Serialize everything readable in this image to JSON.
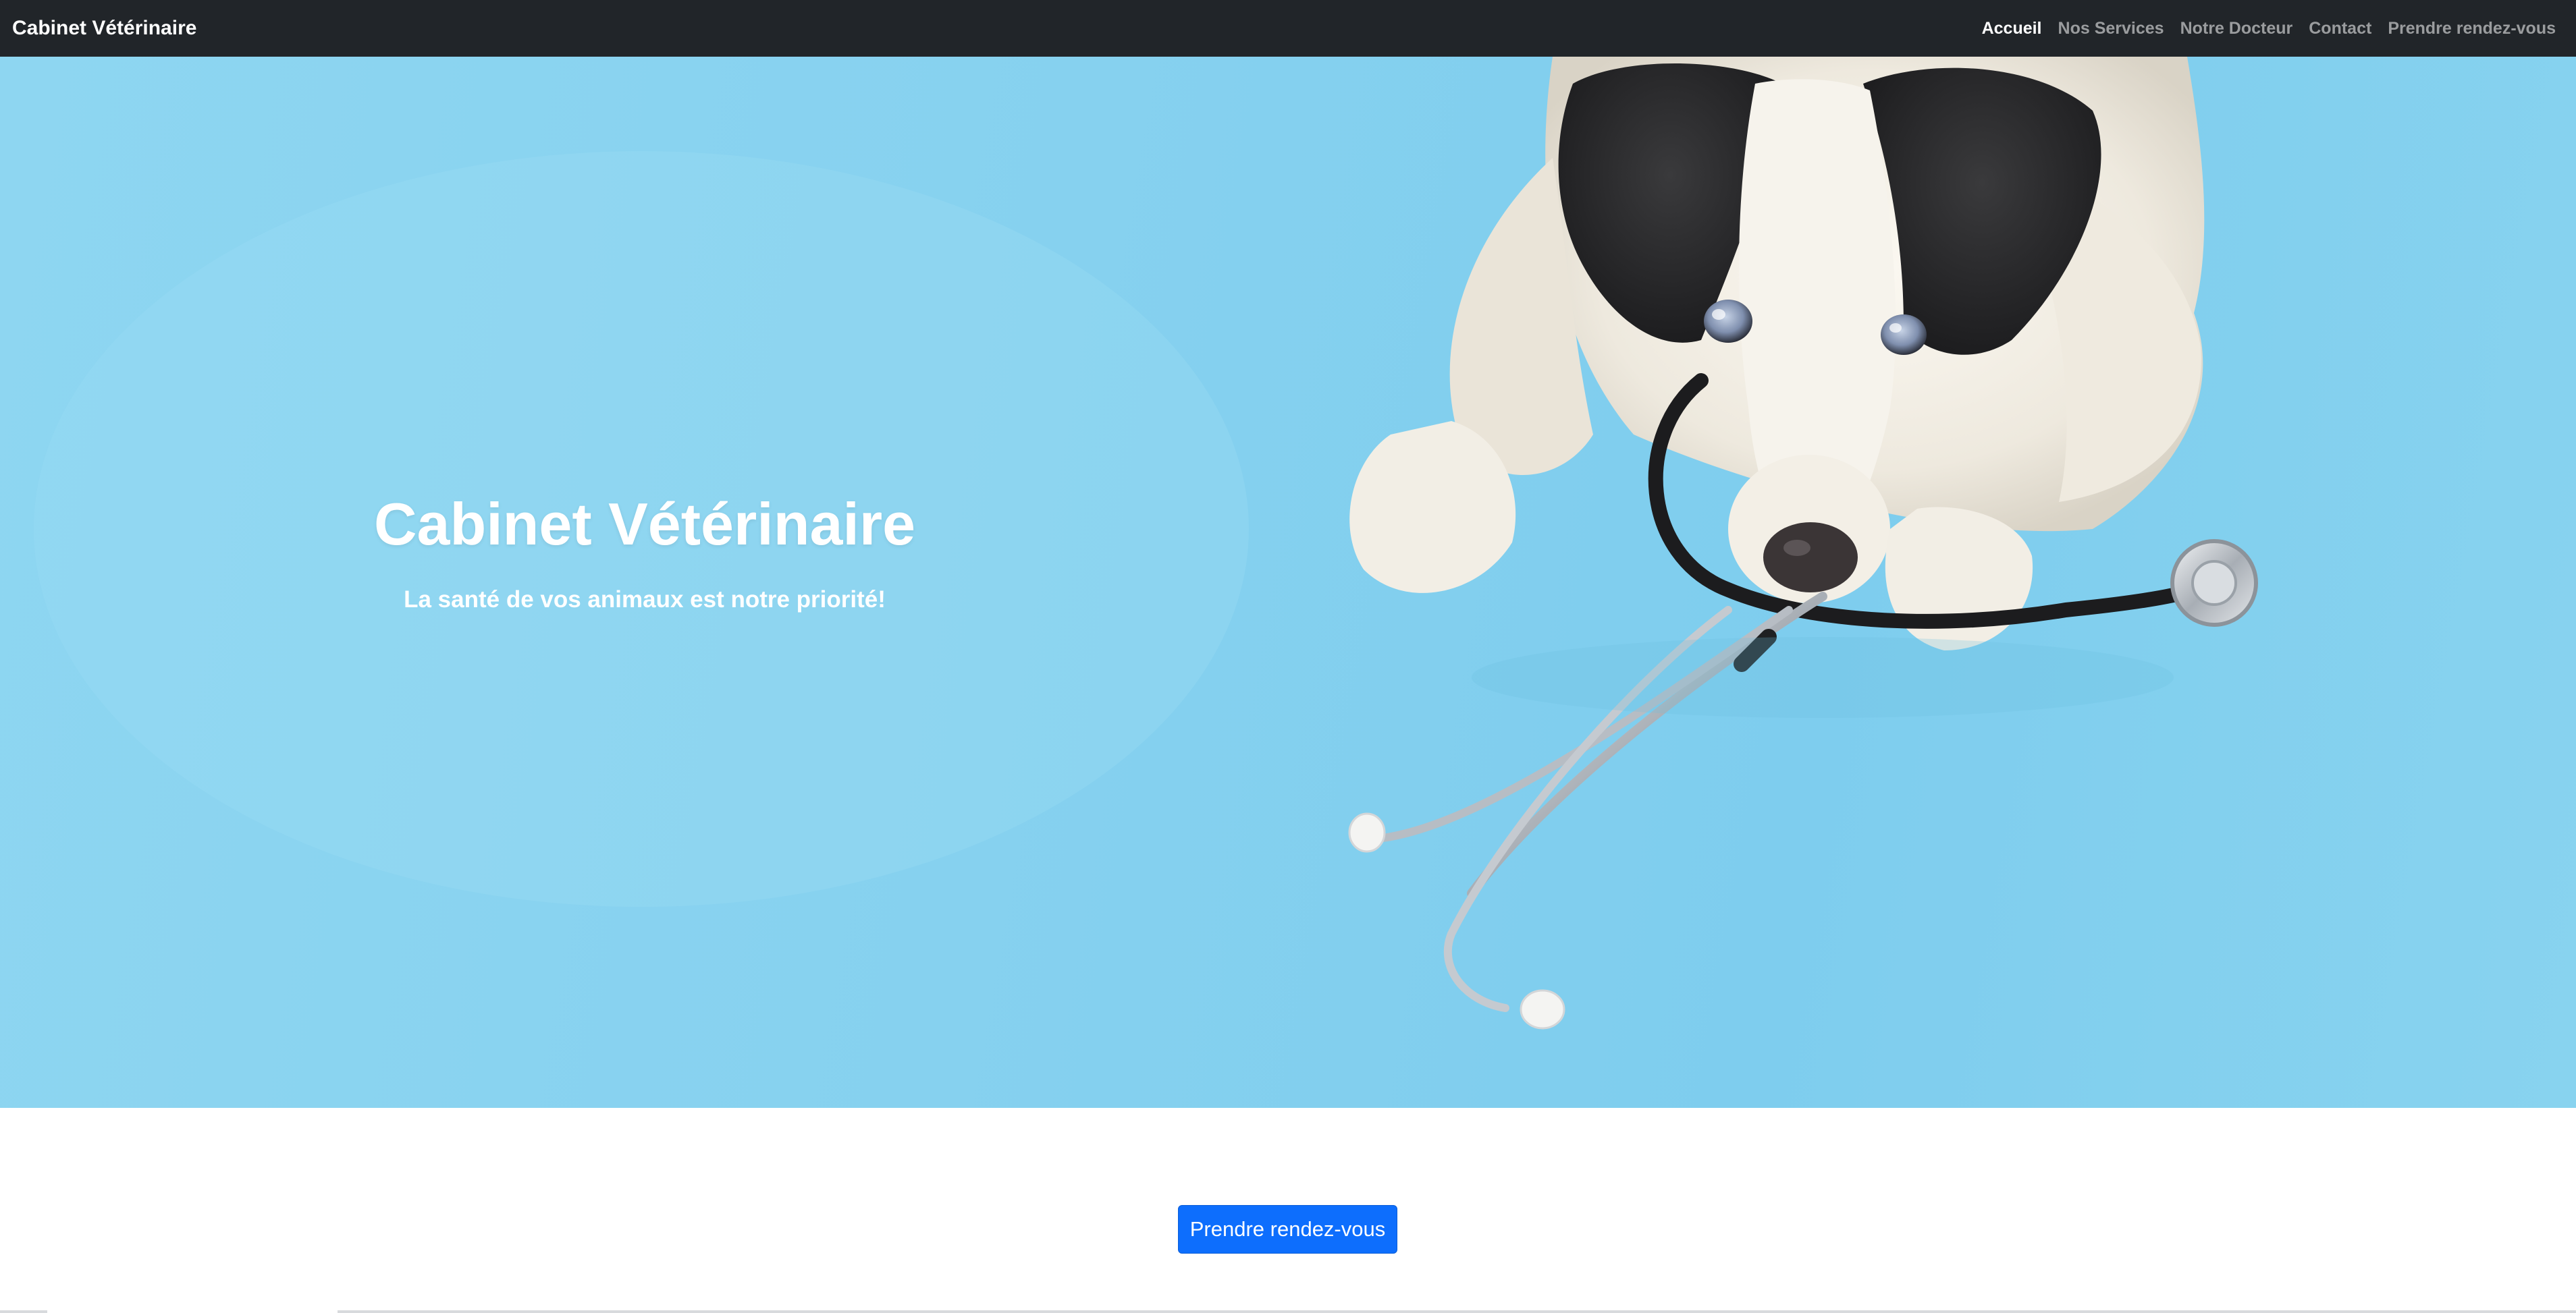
{
  "navbar": {
    "brand": "Cabinet Vétérinaire",
    "links": [
      {
        "label": "Accueil",
        "active": true
      },
      {
        "label": "Nos Services",
        "active": false
      },
      {
        "label": "Notre Docteur",
        "active": false
      },
      {
        "label": "Contact",
        "active": false
      },
      {
        "label": "Prendre rendez-vous",
        "active": false
      }
    ]
  },
  "hero": {
    "title": "Cabinet Vétérinaire",
    "subtitle": "La santé de vos animaux est notre priorité!",
    "image": "dog-with-stethoscope-photo"
  },
  "cta": {
    "label": "Prendre rendez-vous"
  },
  "colors": {
    "navbar_bg": "#212529",
    "hero_bg": "#86d1ef",
    "primary_button": "#0d6efd"
  }
}
